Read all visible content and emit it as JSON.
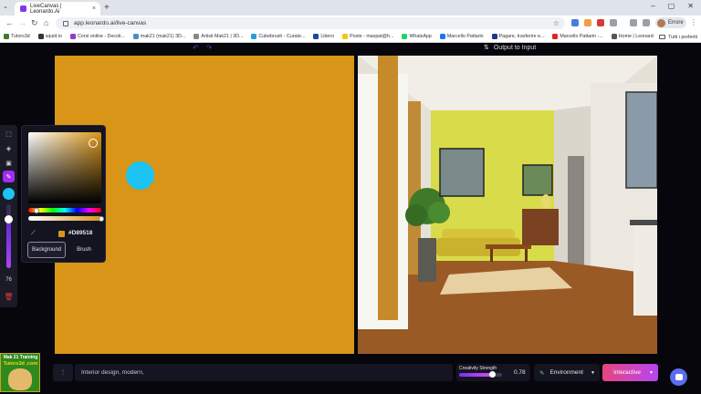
{
  "browser": {
    "tab_title": "LiveCanvas | Leonardo.Ai",
    "new_tab": "+",
    "url": "app.leonardo.ai/live-canvas",
    "profile_label": "Errore",
    "bookmarks": [
      {
        "label": "Tutors3d",
        "color": "#3d7b2b"
      },
      {
        "label": "squid.io",
        "color": "#333333"
      },
      {
        "label": "Corsi online - Decoli...",
        "color": "#8c3fd1"
      },
      {
        "label": "mak21 (mak21) 3D...",
        "color": "#4a90c2"
      },
      {
        "label": "Artisti Mak21 | 3D...",
        "color": "#888888"
      },
      {
        "label": "Cubebrush - Curate...",
        "color": "#27a0d8"
      },
      {
        "label": "Libero",
        "color": "#1a4b9c"
      },
      {
        "label": "Poste - maxpat@h...",
        "color": "#f0c814"
      },
      {
        "label": "WhatsApp",
        "color": "#25d366"
      },
      {
        "label": "Marcello Pattarin",
        "color": "#1877f2"
      },
      {
        "label": "Pagare, trasferire e...",
        "color": "#1f3a8a"
      },
      {
        "label": "Marcello Pattarin -...",
        "color": "#e02424"
      },
      {
        "label": "Home | Leonardo.Ai",
        "color": "#555555"
      }
    ],
    "all_bookmarks": "Tutti i preferiti"
  },
  "toolbar_top": {
    "output_to_input": "Output to Input"
  },
  "left_tools": {
    "brush_size": "76",
    "brush_size_fraction": 0.76
  },
  "color_picker": {
    "hex": "#D89518",
    "tab_background": "Background",
    "tab_brush": "Brush",
    "hue_fraction": 0.11,
    "alpha_fraction": 1.0,
    "saturation_fraction": 0.89,
    "value_fraction": 0.85
  },
  "canvas": {
    "background_color": "#D89518",
    "brush_color": "#1cc3f3"
  },
  "bottom_bar": {
    "prompt": "Interior design, modern,",
    "creativity_label": "Creativity Strength",
    "creativity_value": "0.78",
    "creativity_fraction": 0.78,
    "environment": "Environment",
    "mode": "Interactive"
  },
  "watermark": {
    "line1": "Mak 21 Training",
    "line2": "Tutors3d .com"
  },
  "colors": {
    "accent": "#a02cf3",
    "interactive_start": "#e7457e",
    "interactive_end": "#b746f0"
  }
}
